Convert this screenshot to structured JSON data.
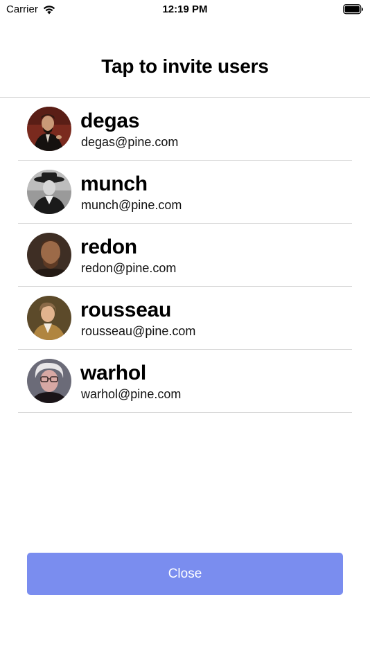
{
  "status_bar": {
    "carrier": "Carrier",
    "time": "12:19 PM",
    "wifi_icon": "wifi-icon",
    "battery_icon": "battery-icon"
  },
  "header": {
    "title": "Tap to invite users"
  },
  "users": [
    {
      "name": "degas",
      "email": "degas@pine.com",
      "avatar": "degas-avatar"
    },
    {
      "name": "munch",
      "email": "munch@pine.com",
      "avatar": "munch-avatar"
    },
    {
      "name": "redon",
      "email": "redon@pine.com",
      "avatar": "redon-avatar"
    },
    {
      "name": "rousseau",
      "email": "rousseau@pine.com",
      "avatar": "rousseau-avatar"
    },
    {
      "name": "warhol",
      "email": "warhol@pine.com",
      "avatar": "warhol-avatar"
    }
  ],
  "footer": {
    "close_label": "Close"
  },
  "colors": {
    "button_background": "#7a8def",
    "button_text": "#ffffff",
    "divider": "#d8d8d8"
  }
}
